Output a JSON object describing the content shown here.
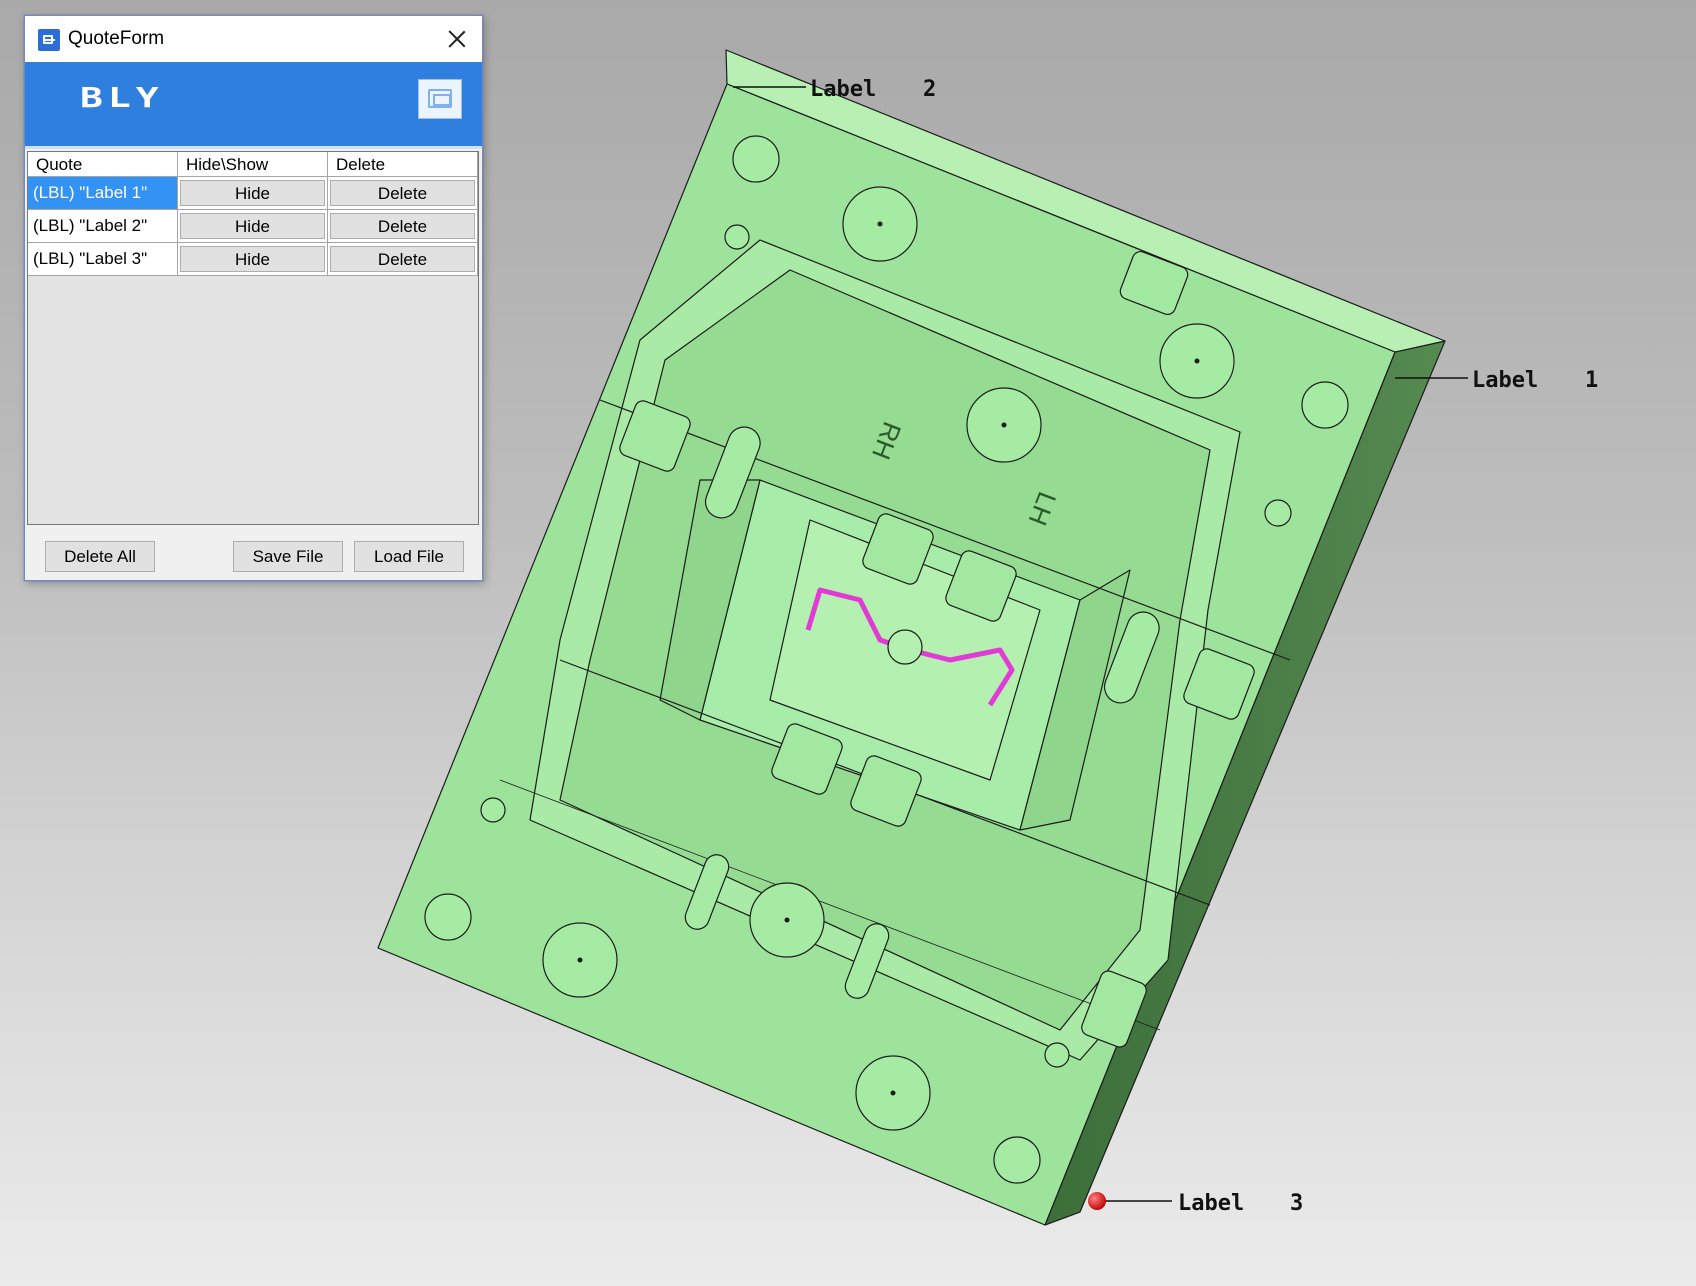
{
  "window": {
    "title": "QuoteForm",
    "brand": "BLY"
  },
  "grid": {
    "columns": [
      "Quote",
      "Hide\\Show",
      "Delete"
    ],
    "rows": [
      {
        "quote": "(LBL) \"Label 1\"",
        "hide": "Hide",
        "delete": "Delete",
        "selected": true
      },
      {
        "quote": "(LBL) \"Label 2\"",
        "hide": "Hide",
        "delete": "Delete",
        "selected": false
      },
      {
        "quote": "(LBL) \"Label 3\"",
        "hide": "Hide",
        "delete": "Delete",
        "selected": false
      }
    ]
  },
  "footer": {
    "delete_all": "Delete All",
    "save_file": "Save File",
    "load_file": "Load File"
  },
  "scene": {
    "labels": [
      {
        "name": "Label",
        "num": "2"
      },
      {
        "name": "Label",
        "num": "1"
      },
      {
        "name": "Label",
        "num": "3"
      }
    ],
    "part_engraving": [
      "RH",
      "LH"
    ],
    "colors": {
      "part": "#9ee39b",
      "accent_pipe": "#e23ad6",
      "marker": "#e01010",
      "selection": "#3393f5",
      "banner": "#2f7fde"
    }
  }
}
